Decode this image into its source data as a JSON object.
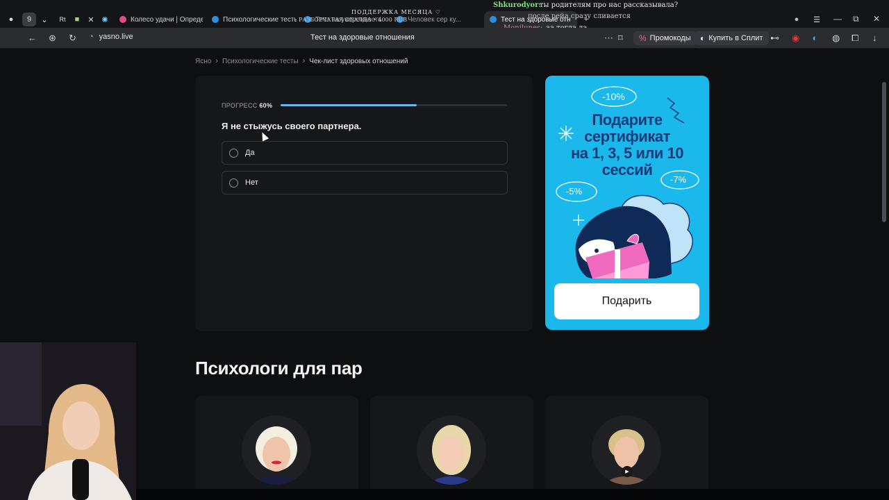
{
  "overlay": {
    "support_title": "ПОДДЕРЖКА МЕСЯЦА ♡",
    "support_sub": "РАЗБОРЧАТАЯ ОБАЛДА • 4000 RUB",
    "chat_user": "Shkurodyor:",
    "chat_message": "ты родителям про нас рассказывала?",
    "chat_line2": "после рейа сразу сливается",
    "chat_user2": "Monilunes:",
    "chat_line3": "аа тогда да"
  },
  "tabs": [
    {
      "label": "Колесо удачи | Определи"
    },
    {
      "label": "Психологические тесты"
    },
    {
      "label": "Тест на уверенность"
    },
    {
      "label": "Человек сер ку..."
    },
    {
      "label": "Тест на здоровые отн",
      "active": true
    }
  ],
  "addressbar": {
    "url": "yasno.live",
    "page_title": "Тест на здоровые отношения",
    "promo_ext": "Промокоды",
    "split_ext": "Купить в Сплит"
  },
  "breadcrumbs": [
    "Ясно",
    "Психологические тесты",
    "Чек-лист здоровых отношений"
  ],
  "test": {
    "progress_label": "ПРОГРЕСС",
    "progress_value": "60%",
    "progress_fraction": 0.6,
    "question": "Я не стыжусь своего партнера.",
    "options": [
      "Да",
      "Нет"
    ]
  },
  "promo": {
    "title_line1": "Подарите",
    "title_line2": "сертификат",
    "title_line3": "на 1, 3, 5 или 10",
    "title_line4": "сессий",
    "badge1": "-10%",
    "badge2": "-5%",
    "badge3": "-7%",
    "button": "Подарить",
    "colors": {
      "bg": "#1bb8ec",
      "title": "#173a78"
    }
  },
  "section": {
    "title": "Психологи для пар"
  },
  "colors": {
    "accent": "#6bb6e9",
    "page_bg": "#0d0f11",
    "card_bg": "#15171a"
  }
}
